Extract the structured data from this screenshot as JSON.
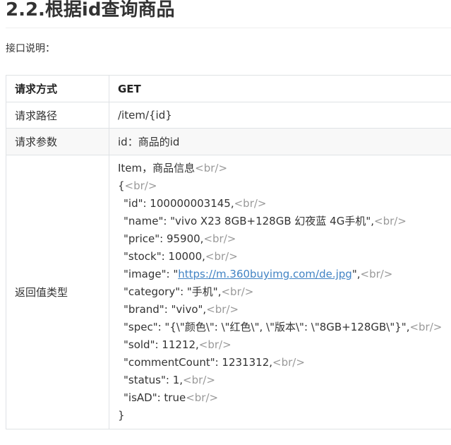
{
  "page": {
    "title": "2.2.根据id查询商品",
    "description": "接口说明："
  },
  "table": {
    "header": {
      "key": "请求方式",
      "value": "GET"
    },
    "path": {
      "key": "请求路径",
      "value": "/item/{id}"
    },
    "params": {
      "key": "请求参数",
      "value": "id：商品的id"
    },
    "return_type": {
      "key": "返回值类型",
      "lines": [
        {
          "text": "Item，商品信息",
          "br": "<br/>"
        },
        {
          "text": "{",
          "br": "<br/>"
        },
        {
          "text": "\"id\": 100000003145,",
          "br": "<br/>"
        },
        {
          "text": "\"name\": \"vivo X23 8GB+128GB 幻夜蓝 4G手机\",",
          "br": "<br/>"
        },
        {
          "text": "\"price\": 95900,",
          "br": "<br/>"
        },
        {
          "text": "\"stock\": 10000,",
          "br": "<br/>"
        },
        {
          "pre": "\"image\": \"",
          "link": "https://m.360buyimg.com/de.jpg",
          "post": "\",",
          "br": "<br/>"
        },
        {
          "text": "\"category\": \"手机\",",
          "br": "<br/>"
        },
        {
          "text": "\"brand\": \"vivo\",",
          "br": "<br/>"
        },
        {
          "text": "\"spec\": \"{\\\"颜色\\\": \\\"红色\\\", \\\"版本\\\": \\\"8GB+128GB\\\"}\",",
          "br": "<br/>"
        },
        {
          "text": "\"sold\": 11212,",
          "br": "<br/>"
        },
        {
          "text": "\"commentCount\": 1231312,",
          "br": "<br/>"
        },
        {
          "text": "\"status\": 1,",
          "br": "<br/>"
        },
        {
          "text": "\"isAD\": true",
          "br": "<br/>"
        },
        {
          "text": "}"
        }
      ]
    }
  }
}
